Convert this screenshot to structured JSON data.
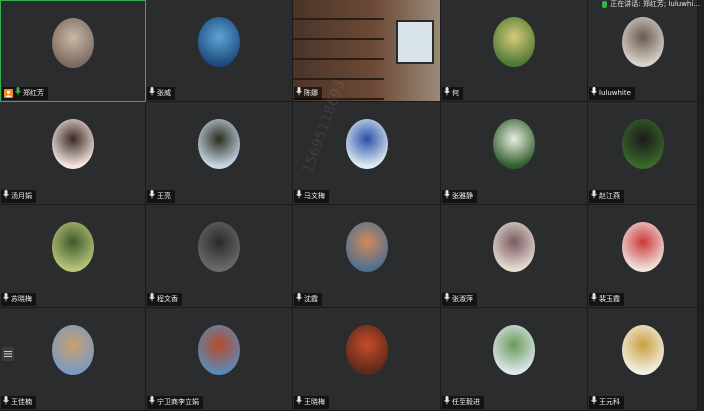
{
  "speaking_indicator": "正在讲话: 郑红芳; luluwhi...",
  "watermark": "15695118693",
  "participants": [
    {
      "name": "郑红芳",
      "avatar": "photo-portrait",
      "colors": [
        "#7a6a60",
        "#c9b8a6"
      ],
      "host": true,
      "active": true,
      "mic": "on"
    },
    {
      "name": "张威",
      "avatar": "landscape-blue",
      "colors": [
        "#1d4a7d",
        "#5fa3d6"
      ]
    },
    {
      "name": "陈娜",
      "avatar": "bookshelf",
      "colors": [
        "#4a3428",
        "#9a8a78"
      ],
      "fullframe": true
    },
    {
      "name": "何",
      "avatar": "landscape-hills",
      "colors": [
        "#4d7a35",
        "#d9c97a"
      ]
    },
    {
      "name": "luluwhite",
      "avatar": "deer",
      "colors": [
        "#d9d4cc",
        "#6a5a4e"
      ],
      "mic": "on"
    },
    {
      "name": "汤月娟",
      "avatar": "cartoon-girl",
      "colors": [
        "#f7e8e2",
        "#3b2a26"
      ]
    },
    {
      "name": "王亮",
      "avatar": "flowers-dark",
      "colors": [
        "#c8d8e8",
        "#2b2d1e"
      ]
    },
    {
      "name": "马文梅",
      "avatar": "blue-rose",
      "colors": [
        "#dfeef2",
        "#2b4fa8"
      ]
    },
    {
      "name": "张雅静",
      "avatar": "green-plant",
      "colors": [
        "#2f5b2a",
        "#e9eee2"
      ]
    },
    {
      "name": "赵江燕",
      "avatar": "dog",
      "colors": [
        "#3b6a2a",
        "#1a1a1a"
      ]
    },
    {
      "name": "苏晓梅",
      "avatar": "field",
      "colors": [
        "#b9c67a",
        "#3e5a2a"
      ]
    },
    {
      "name": "程文香",
      "avatar": "person-dark",
      "colors": [
        "#6a6a6a",
        "#2a2a2a"
      ]
    },
    {
      "name": "沈霞",
      "avatar": "toy",
      "colors": [
        "#4f6f8f",
        "#d08a5a"
      ]
    },
    {
      "name": "张淑萍",
      "avatar": "children-photo",
      "colors": [
        "#e6dcd2",
        "#7a5a62"
      ]
    },
    {
      "name": "裴玉霞",
      "avatar": "cartoon-hat",
      "colors": [
        "#f1e4de",
        "#c93a3a"
      ]
    },
    {
      "name": "王佳楠",
      "avatar": "town",
      "colors": [
        "#7a9ac2",
        "#c8a070"
      ]
    },
    {
      "name": "宁卫商李立娟",
      "avatar": "berries",
      "colors": [
        "#5a8ab8",
        "#b84a2a"
      ]
    },
    {
      "name": "王晓梅",
      "avatar": "anime-room",
      "colors": [
        "#5a2a1a",
        "#c94a2a"
      ]
    },
    {
      "name": "任至毅进",
      "avatar": "seaside",
      "colors": [
        "#dfe8f0",
        "#6a9a5a"
      ]
    },
    {
      "name": "王元科",
      "avatar": "gold-figure",
      "colors": [
        "#f4f0e6",
        "#c8a040"
      ]
    }
  ]
}
